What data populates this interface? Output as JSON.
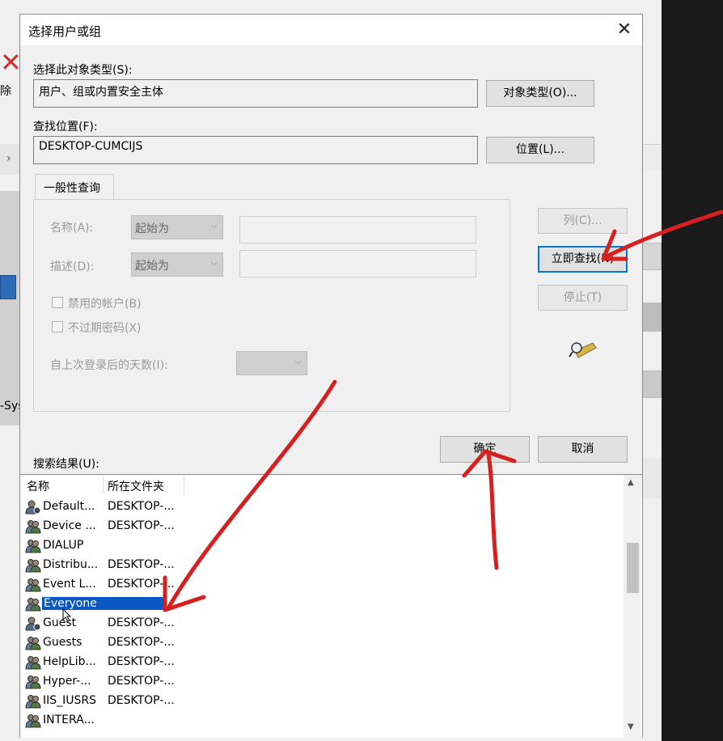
{
  "background_window": {
    "delete_label": "除",
    "side_label": "-Sys"
  },
  "dialog": {
    "title": "选择用户或组",
    "object_type": {
      "label": "选择此对象类型(S):",
      "value": "用户、组或内置安全主体",
      "button": "对象类型(O)..."
    },
    "location": {
      "label": "查找位置(F):",
      "value": "DESKTOP-CUMCIJS",
      "button": "位置(L)..."
    },
    "tab": "一般性查询",
    "name_field": {
      "label": "名称(A):",
      "combo": "起始为"
    },
    "desc_field": {
      "label": "描述(D):",
      "combo": "起始为"
    },
    "check_disabled": "禁用的帐户(B)",
    "check_noexpire": "不过期密码(X)",
    "days_label": "自上次登录后的天数(I):",
    "btn_columns": "列(C)...",
    "btn_find_now": "立即查找(N)",
    "btn_stop": "停止(T)",
    "btn_ok": "确定",
    "btn_cancel": "取消",
    "results_label": "搜索结果(U):",
    "columns": [
      "名称",
      "所在文件夹"
    ],
    "results": [
      {
        "name": "Default...",
        "folder": "DESKTOP-...",
        "icon": "user-icon",
        "selected": false
      },
      {
        "name": "Device ...",
        "folder": "DESKTOP-...",
        "icon": "group-icon",
        "selected": false
      },
      {
        "name": "DIALUP",
        "folder": "",
        "icon": "group-icon",
        "selected": false
      },
      {
        "name": "Distribu...",
        "folder": "DESKTOP-...",
        "icon": "group-icon",
        "selected": false
      },
      {
        "name": "Event L...",
        "folder": "DESKTOP-...",
        "icon": "group-icon",
        "selected": false
      },
      {
        "name": "Everyone",
        "folder": "",
        "icon": "group-icon",
        "selected": true
      },
      {
        "name": "Guest",
        "folder": "DESKTOP-...",
        "icon": "user-icon",
        "selected": false
      },
      {
        "name": "Guests",
        "folder": "DESKTOP-...",
        "icon": "group-icon",
        "selected": false
      },
      {
        "name": "HelpLib...",
        "folder": "DESKTOP-...",
        "icon": "group-icon",
        "selected": false
      },
      {
        "name": "Hyper-...",
        "folder": "DESKTOP-...",
        "icon": "group-icon",
        "selected": false
      },
      {
        "name": "IIS_IUSRS",
        "folder": "DESKTOP-...",
        "icon": "group-icon",
        "selected": false
      },
      {
        "name": "INTERA...",
        "folder": "",
        "icon": "group-icon",
        "selected": false
      }
    ]
  },
  "colors": {
    "selection": "#0a58c6",
    "annotation": "#d62020",
    "focus_border": "#0078d7"
  }
}
